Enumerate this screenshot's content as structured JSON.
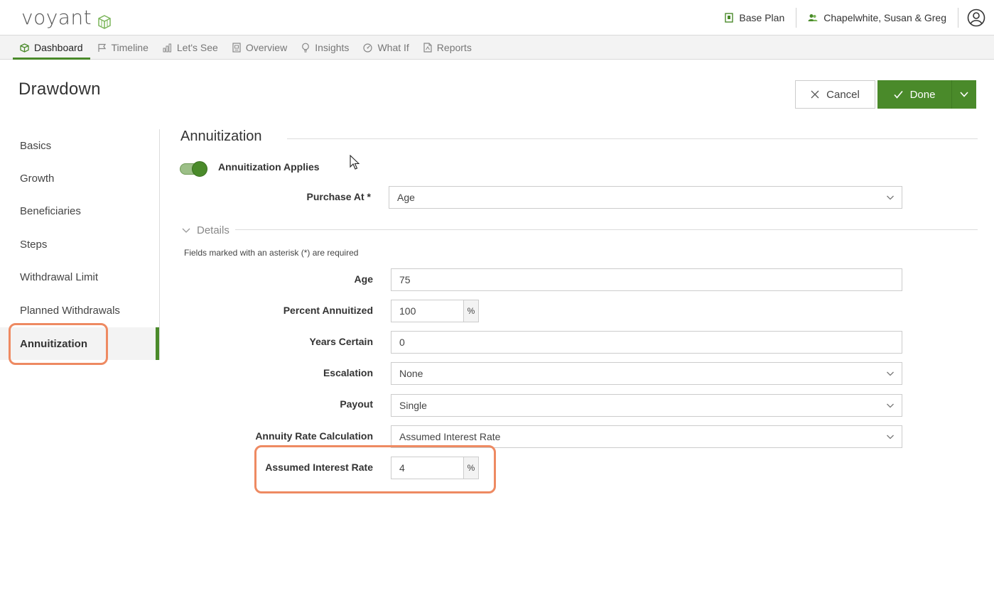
{
  "header": {
    "logo_text": "voyant",
    "plan_label": "Base Plan",
    "client_name": "Chapelwhite, Susan & Greg"
  },
  "nav": {
    "tabs": [
      {
        "label": "Dashboard",
        "icon": "cube-icon",
        "active": true
      },
      {
        "label": "Timeline",
        "icon": "flag-icon"
      },
      {
        "label": "Let's See",
        "icon": "bar-chart-icon"
      },
      {
        "label": "Overview",
        "icon": "overview-icon"
      },
      {
        "label": "Insights",
        "icon": "lightbulb-icon"
      },
      {
        "label": "What If",
        "icon": "gauge-icon"
      },
      {
        "label": "Reports",
        "icon": "pdf-icon"
      }
    ]
  },
  "page": {
    "title": "Drawdown",
    "cancel_label": "Cancel",
    "done_label": "Done"
  },
  "sidenav": {
    "items": [
      {
        "label": "Basics"
      },
      {
        "label": "Growth"
      },
      {
        "label": "Beneficiaries"
      },
      {
        "label": "Steps"
      },
      {
        "label": "Withdrawal Limit"
      },
      {
        "label": "Planned Withdrawals"
      },
      {
        "label": "Annuitization",
        "active": true
      }
    ]
  },
  "section": {
    "title": "Annuitization",
    "toggle_label": "Annuitization Applies",
    "toggle_on": true,
    "purchase_at": {
      "label": "Purchase At *",
      "value": "Age"
    },
    "details_label": "Details",
    "required_note": "Fields marked with an asterisk (*) are required",
    "fields": {
      "age": {
        "label": "Age",
        "value": "75"
      },
      "percent_annuitized": {
        "label": "Percent Annuitized",
        "value": "100",
        "unit": "%"
      },
      "years_certain": {
        "label": "Years Certain",
        "value": "0"
      },
      "escalation": {
        "label": "Escalation",
        "value": "None"
      },
      "payout": {
        "label": "Payout",
        "value": "Single"
      },
      "annuity_rate_calc": {
        "label": "Annuity Rate Calculation",
        "value": "Assumed Interest Rate"
      },
      "assumed_interest_rate": {
        "label": "Assumed Interest Rate",
        "value": "4",
        "unit": "%"
      }
    }
  },
  "colors": {
    "accent": "#4a8a2a",
    "highlight": "#ee8a62"
  }
}
